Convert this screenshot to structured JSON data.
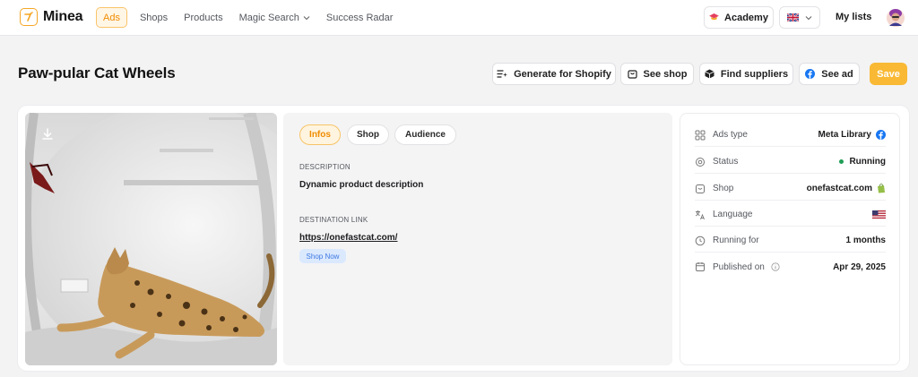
{
  "app": {
    "name": "Minea",
    "brand_color": "#f5a623"
  },
  "nav": {
    "items": [
      {
        "label": "Ads",
        "active": true
      },
      {
        "label": "Shops"
      },
      {
        "label": "Products"
      },
      {
        "label": "Magic Search",
        "has_dropdown": true
      },
      {
        "label": "Success Radar"
      }
    ],
    "academy_label": "Academy",
    "language_flag": "uk-flag-icon",
    "my_lists_label": "My lists"
  },
  "header": {
    "title": "Paw-pular Cat Wheels",
    "buttons": {
      "generate": "Generate for Shopify",
      "see_shop": "See shop",
      "find_suppliers": "Find suppliers",
      "see_ad": "See ad",
      "save": "Save"
    }
  },
  "info": {
    "tabs": [
      "Infos",
      "Shop",
      "Audience"
    ],
    "active_tab": "Infos",
    "description_label": "DESCRIPTION",
    "description": "Dynamic product description",
    "destination_label": "DESTINATION LINK",
    "destination_url": "https://onefastcat.com/",
    "cta": "Shop Now"
  },
  "details": {
    "rows": [
      {
        "key": "Ads type",
        "value": "Meta Library",
        "icon": "grid-icon",
        "value_icon": "facebook-icon"
      },
      {
        "key": "Status",
        "value": "Running",
        "icon": "gear-icon",
        "status_color": "#1f9d55"
      },
      {
        "key": "Shop",
        "value": "onefastcat.com",
        "icon": "bag-icon",
        "value_icon": "shopify-icon"
      },
      {
        "key": "Language",
        "value": "",
        "icon": "translate-icon",
        "value_icon": "us-flag-icon"
      },
      {
        "key": "Running for",
        "value": "1 months",
        "icon": "clock-icon"
      },
      {
        "key": "Published on",
        "value": "Apr 29, 2025",
        "icon": "calendar-icon",
        "key_icon": "info-icon"
      }
    ]
  }
}
